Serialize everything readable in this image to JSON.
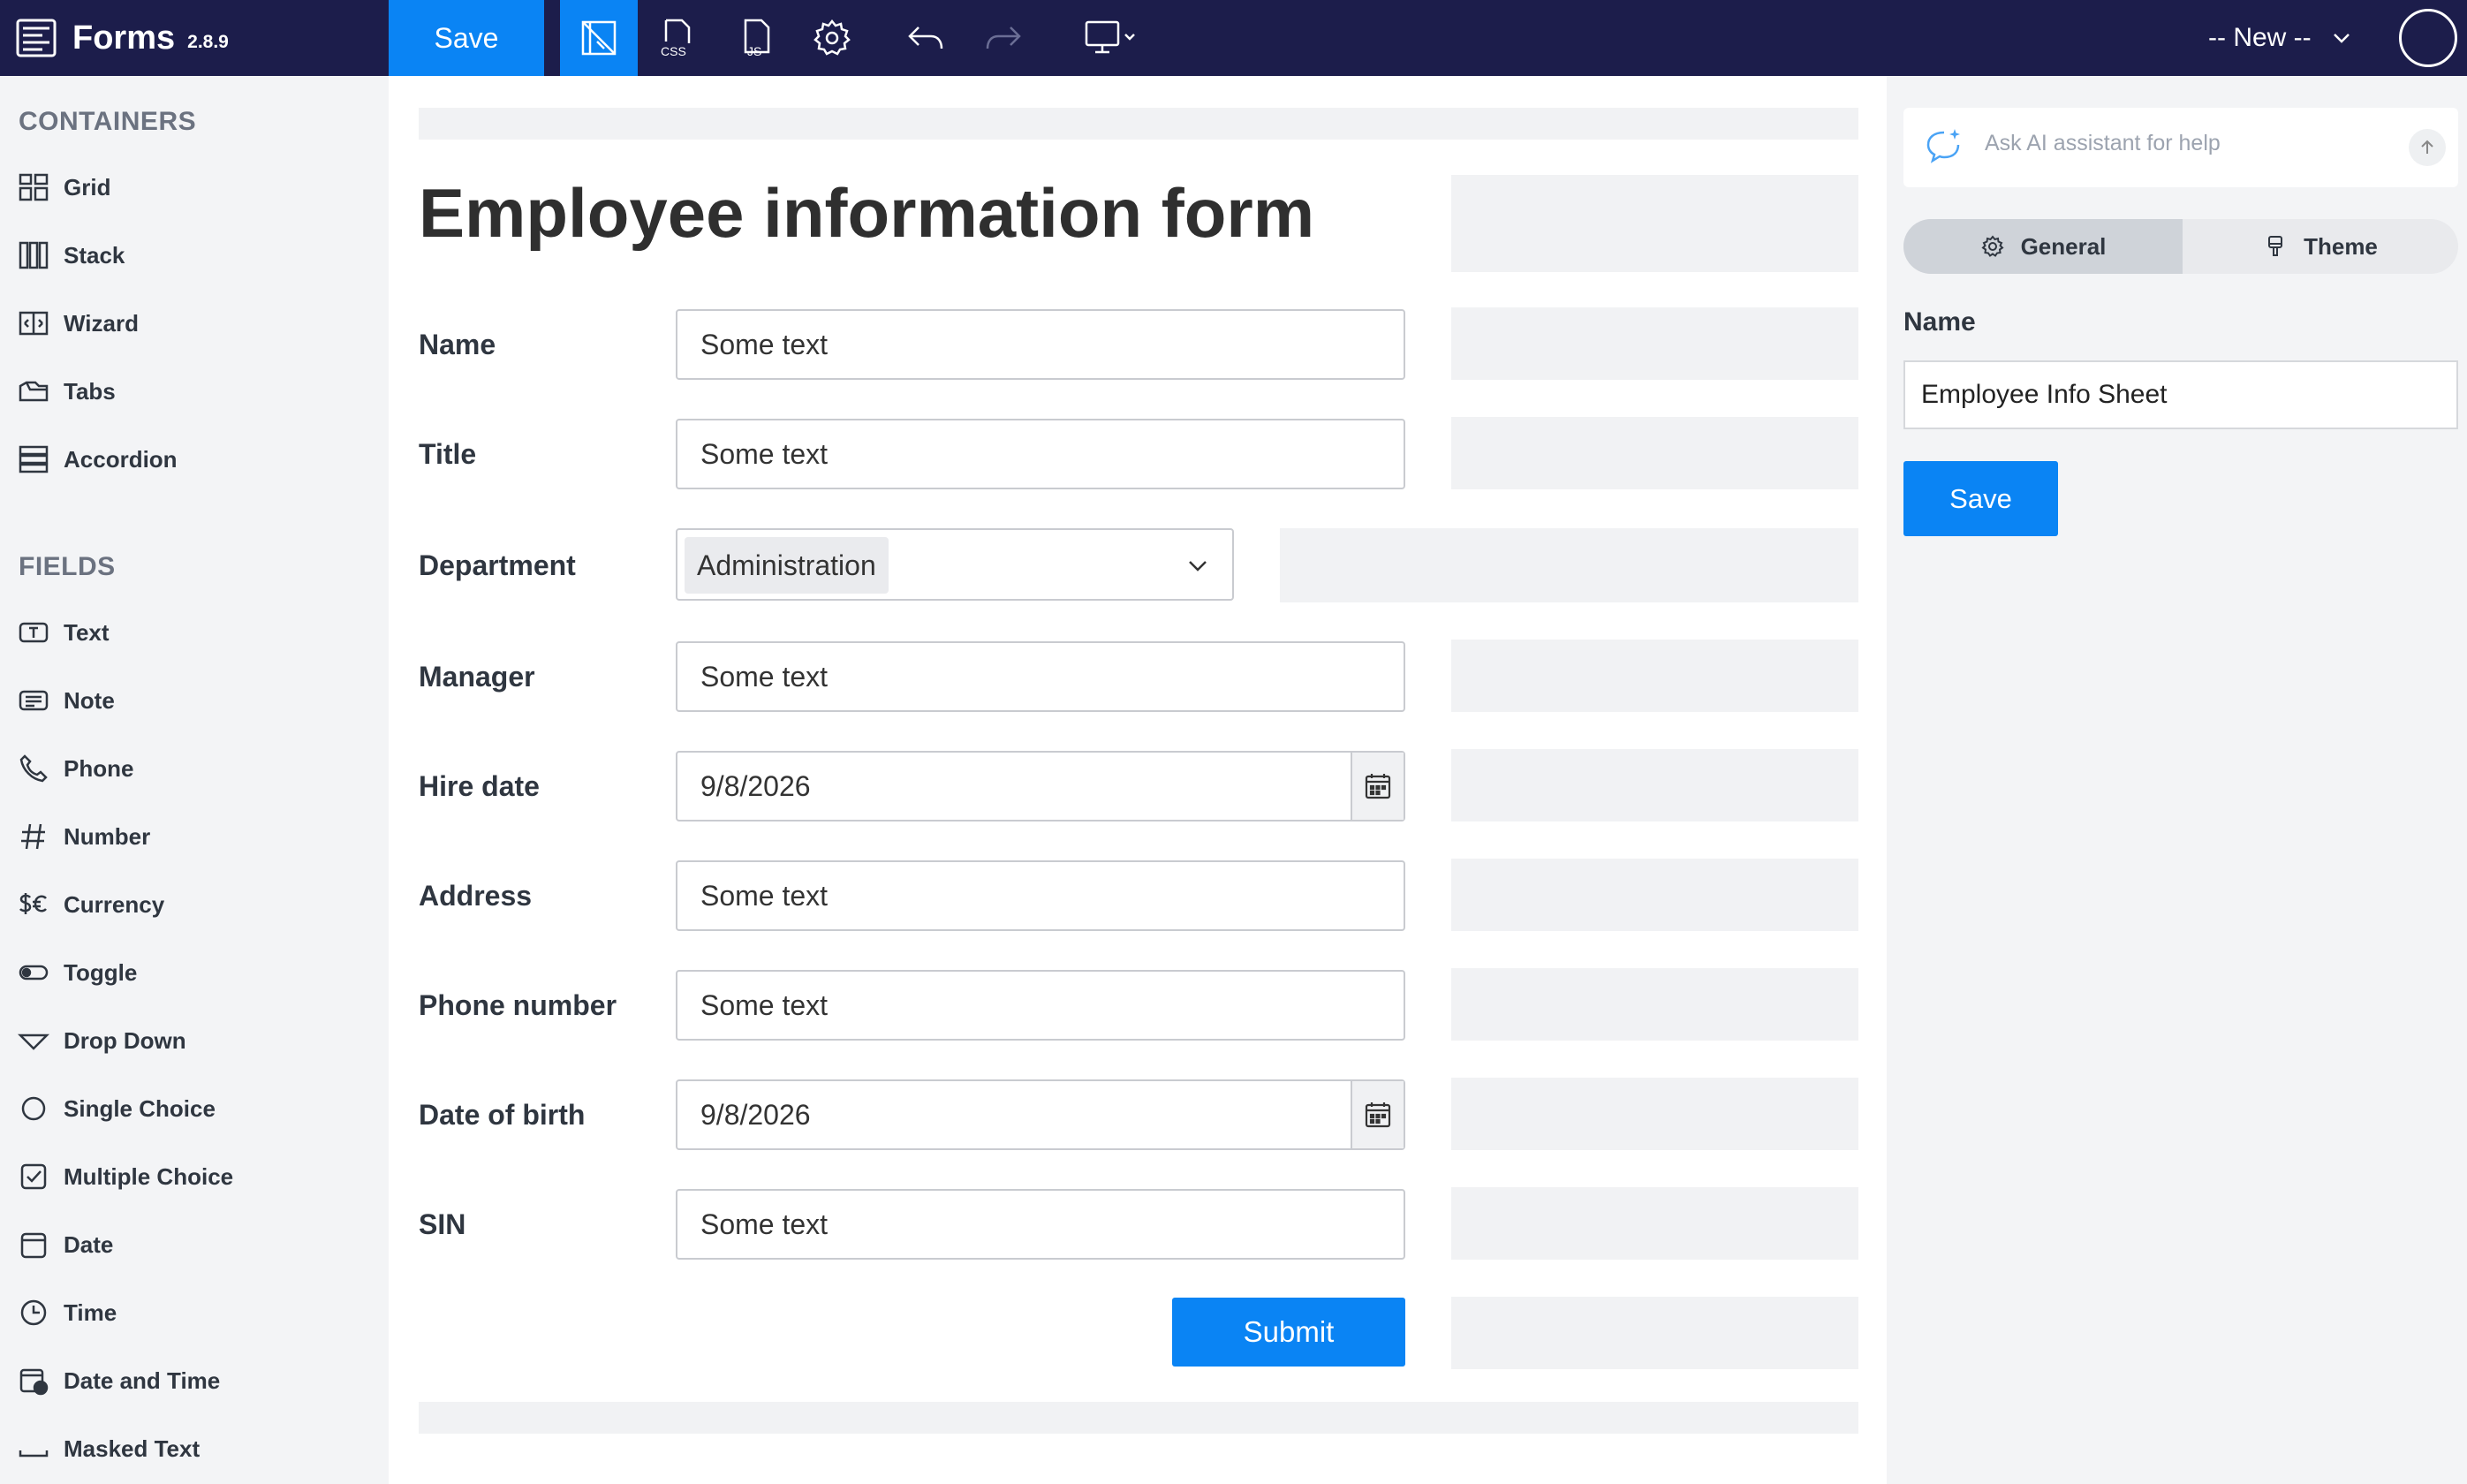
{
  "app": {
    "name": "Forms",
    "version": "2.8.9"
  },
  "toolbar": {
    "save_label": "Save",
    "new_select_value": "-- New --",
    "icons": [
      "designer-icon",
      "css-icon",
      "js-icon",
      "settings-icon",
      "undo-icon",
      "redo-icon",
      "preview-device-icon"
    ]
  },
  "sidebar": {
    "containers_title": "CONTAINERS",
    "containers": [
      {
        "label": "Grid",
        "icon": "grid-icon"
      },
      {
        "label": "Stack",
        "icon": "stack-icon"
      },
      {
        "label": "Wizard",
        "icon": "wizard-icon"
      },
      {
        "label": "Tabs",
        "icon": "tabs-icon"
      },
      {
        "label": "Accordion",
        "icon": "accordion-icon"
      }
    ],
    "fields_title": "FIELDS",
    "fields": [
      {
        "label": "Text",
        "icon": "text-field-icon"
      },
      {
        "label": "Note",
        "icon": "note-icon"
      },
      {
        "label": "Phone",
        "icon": "phone-icon"
      },
      {
        "label": "Number",
        "icon": "number-icon"
      },
      {
        "label": "Currency",
        "icon": "currency-icon"
      },
      {
        "label": "Toggle",
        "icon": "toggle-icon"
      },
      {
        "label": "Drop Down",
        "icon": "dropdown-icon"
      },
      {
        "label": "Single Choice",
        "icon": "single-choice-icon"
      },
      {
        "label": "Multiple Choice",
        "icon": "multiple-choice-icon"
      },
      {
        "label": "Date",
        "icon": "date-icon"
      },
      {
        "label": "Time",
        "icon": "time-icon"
      },
      {
        "label": "Date and Time",
        "icon": "date-time-icon"
      },
      {
        "label": "Masked Text",
        "icon": "masked-text-icon"
      }
    ]
  },
  "form": {
    "title": "Employee information form",
    "fields": [
      {
        "label": "Name",
        "value": "Some text",
        "type": "text"
      },
      {
        "label": "Title",
        "value": "Some text",
        "type": "text"
      },
      {
        "label": "Department",
        "value": "Administration",
        "type": "select"
      },
      {
        "label": "Manager",
        "value": "Some text",
        "type": "text"
      },
      {
        "label": "Hire date",
        "value": "9/8/2026",
        "type": "date"
      },
      {
        "label": "Address",
        "value": "Some text",
        "type": "text"
      },
      {
        "label": "Phone number",
        "value": "Some text",
        "type": "text"
      },
      {
        "label": "Date of birth",
        "value": "9/8/2026",
        "type": "date"
      },
      {
        "label": "SIN",
        "value": "Some text",
        "type": "text"
      }
    ],
    "submit_label": "Submit"
  },
  "right_panel": {
    "ai_placeholder": "Ask AI assistant for help",
    "tabs": [
      {
        "label": "General",
        "icon": "gear-icon",
        "active": true
      },
      {
        "label": "Theme",
        "icon": "brush-icon",
        "active": false
      }
    ],
    "name_label": "Name",
    "name_value": "Employee Info Sheet",
    "save_label": "Save"
  },
  "colors": {
    "topbar": "#1c1d4b",
    "accent": "#0a84f4",
    "sidebar_bg": "#f3f4f6"
  }
}
